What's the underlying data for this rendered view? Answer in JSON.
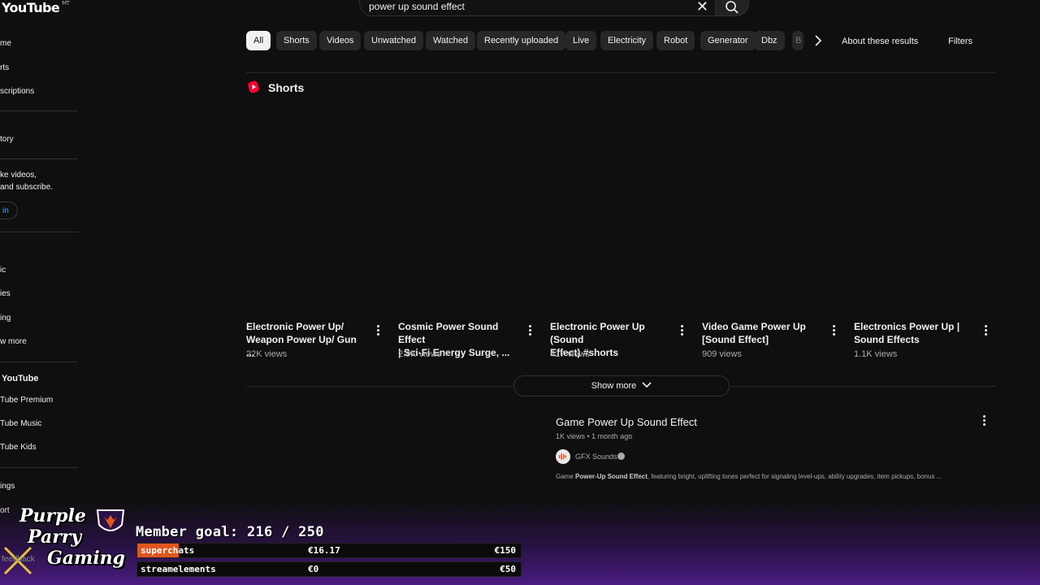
{
  "header": {
    "logo": "YouTube",
    "logo_region": "MT",
    "search_query": "power up sound effect"
  },
  "sidebar": {
    "items_top": [
      "me",
      "rts",
      "scriptions",
      "tory"
    ],
    "signin_note_line1": "ke videos,",
    "signin_note_line2": "and subscribe.",
    "signin_label": "in",
    "explore_items": [
      "ic",
      "ies",
      "ing",
      "w more"
    ],
    "more_heading": "YouTube",
    "more_items": [
      "Tube Premium",
      "Tube Music",
      "Tube Kids"
    ],
    "bottom_items": [
      "ings",
      "ort",
      "feedback"
    ]
  },
  "chips": [
    {
      "label": "All",
      "active": true
    },
    {
      "label": "Shorts"
    },
    {
      "label": "Videos"
    },
    {
      "label": "Unwatched"
    },
    {
      "label": "Watched"
    },
    {
      "label": "Recently uploaded"
    },
    {
      "label": "Live"
    },
    {
      "label": "Electricity"
    },
    {
      "label": "Robot"
    },
    {
      "label": "Generator"
    },
    {
      "label": "Dbz"
    },
    {
      "label": "B"
    }
  ],
  "about_label": "About these results",
  "filters_label": "Filters",
  "shorts_section": {
    "title": "Shorts",
    "items": [
      {
        "line1": "Electronic Power Up/",
        "line2": "Weapon Power Up/ Gun ...",
        "views": "22K views"
      },
      {
        "line1": "Cosmic Power Sound Effect",
        "line2": "| Sci-Fi Energy Surge, ...",
        "views": "2.9K views"
      },
      {
        "line1": "Electronic Power Up (Sound",
        "line2": "Effect) #shorts",
        "views": "417 views"
      },
      {
        "line1": "Video Game Power Up",
        "line2": "[Sound Effect]",
        "views": "909 views"
      },
      {
        "line1": "Electronics Power Up |",
        "line2": "Sound Effects",
        "views": "1.1K views"
      }
    ],
    "show_more": "Show more"
  },
  "video": {
    "title": "Game Power Up Sound Effect",
    "meta": "1K views • 1 month ago",
    "channel": "GFX Sounds",
    "desc_pre": "Game ",
    "desc_bold": "Power-Up Sound Effect",
    "desc_post": ", featuring bright, uplifting tones perfect for signaling level-ups, ability upgrades, item pickups, bonus ..."
  },
  "overlay": {
    "brand_line1": "Purple",
    "brand_line2": "Parry",
    "brand_line3": "Gaming",
    "goal_text": "Member goal: 216 / 250",
    "bars": [
      {
        "label": "superchats",
        "current": "€16.17",
        "target": "€150",
        "fill_fraction": 0.108
      },
      {
        "label": "streamelements",
        "current": "€0",
        "target": "€50",
        "fill_fraction": 0
      }
    ],
    "accent": "#e0561f",
    "purple": "#5a1e96"
  }
}
